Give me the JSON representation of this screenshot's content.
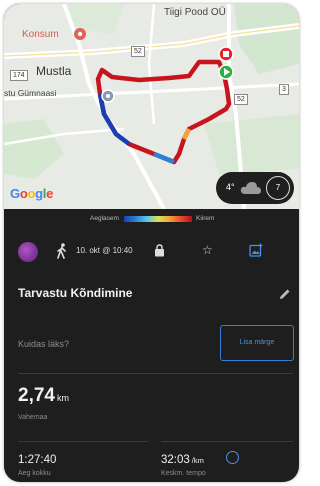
{
  "map": {
    "labels": {
      "shop": "Tiigi Pood OÜ",
      "konsum": "Konsum",
      "town": "Mustla",
      "school": "stu Gümnaasi",
      "road_174": "174",
      "road_52": "52",
      "road_52b": "52",
      "road_3": "3"
    },
    "google": [
      "G",
      "o",
      "o",
      "g",
      "l",
      "e"
    ],
    "google_colors": [
      "#4285f4",
      "#ea4335",
      "#fbbc05",
      "#4285f4",
      "#34a853",
      "#ea4335"
    ]
  },
  "weather": {
    "temp": "4°",
    "wind": "7"
  },
  "legend": {
    "slower": "Aeglasem",
    "faster": "Kiirem"
  },
  "activity": {
    "date": "10. okt @ 10:40",
    "title": "Tarvastu Kõndimine",
    "how_question": "Kuidas läks?",
    "add_note_button": "Lisa märge"
  },
  "stats": {
    "distance_value": "2,74",
    "distance_unit": "km",
    "distance_label": "Vahemaa",
    "time_value": "1:27:40",
    "time_label": "Aeg kokku",
    "pace_value": "32:03",
    "pace_unit": "/km",
    "pace_label": "Keskm. tempo"
  },
  "colors": {
    "accent": "#3a7bd5",
    "background": "#1e1e1e",
    "route_fast": "#c8141c",
    "route_slow": "#1a3fb5"
  }
}
